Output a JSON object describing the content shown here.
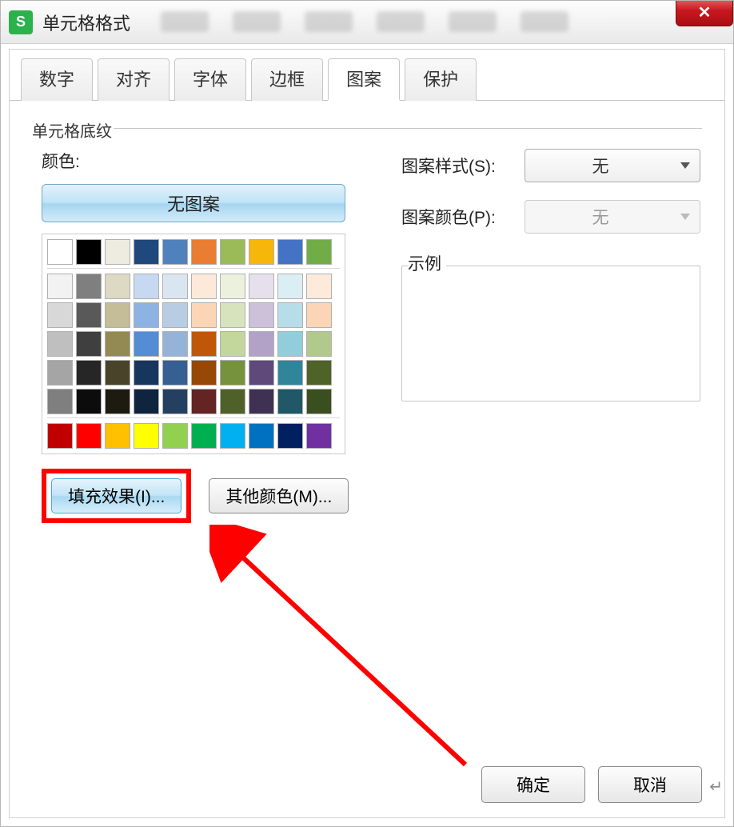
{
  "window": {
    "title": "单元格格式",
    "app_icon_letter": "S",
    "close_glyph": "✕"
  },
  "tabs": {
    "items": [
      "数字",
      "对齐",
      "字体",
      "边框",
      "图案",
      "保护"
    ],
    "active_index": 4
  },
  "fieldset": {
    "legend": "单元格底纹"
  },
  "left": {
    "color_label": "颜色:",
    "no_pattern_button": "无图案",
    "fill_effects_button": "填充效果(I)...",
    "more_colors_button": "其他颜色(M)..."
  },
  "right": {
    "pattern_style_label": "图案样式(S):",
    "pattern_style_value": "无",
    "pattern_color_label": "图案颜色(P):",
    "pattern_color_value": "无",
    "example_label": "示例"
  },
  "footer": {
    "ok": "确定",
    "cancel": "取消"
  },
  "palette": {
    "row1": [
      "#ffffff",
      "#000000",
      "#eeece1",
      "#1f497d",
      "#4f81bd",
      "#e97d31",
      "#9bbb59",
      "#f6b70a",
      "#4472c4",
      "#70ad47"
    ],
    "theme_rows": [
      [
        "#f2f2f2",
        "#7f7f7f",
        "#ddd9c3",
        "#c6d9f0",
        "#dbe5f1",
        "#fde9d9",
        "#ebf1dd",
        "#e5e0ec",
        "#dbeef3",
        "#fdeada"
      ],
      [
        "#d8d8d8",
        "#595959",
        "#c4bd97",
        "#8db3e2",
        "#b8cce4",
        "#fbd5b5",
        "#d7e3bc",
        "#ccc1d9",
        "#b7dde8",
        "#fbd5b5"
      ],
      [
        "#bfbfbf",
        "#3f3f3f",
        "#938953",
        "#548dd4",
        "#95b3d7",
        "#c05708",
        "#c3d69b",
        "#b2a2c7",
        "#92cddc",
        "#b2c98e"
      ],
      [
        "#a5a5a5",
        "#262626",
        "#494429",
        "#17365d",
        "#366092",
        "#984806",
        "#76923c",
        "#5f497a",
        "#31859b",
        "#4f6228"
      ],
      [
        "#7f7f7f",
        "#0c0c0c",
        "#1d1b10",
        "#0f243e",
        "#244061",
        "#632423",
        "#4f6128",
        "#3f3151",
        "#205867",
        "#3a4e1f"
      ]
    ],
    "standard": [
      "#c00000",
      "#ff0000",
      "#ffc000",
      "#ffff00",
      "#92d050",
      "#00b050",
      "#00b0f0",
      "#0070c0",
      "#002060",
      "#7030a0"
    ]
  },
  "annotation": {
    "highlight_target": "fill-effects-button",
    "arrow_color": "#ff0000"
  }
}
